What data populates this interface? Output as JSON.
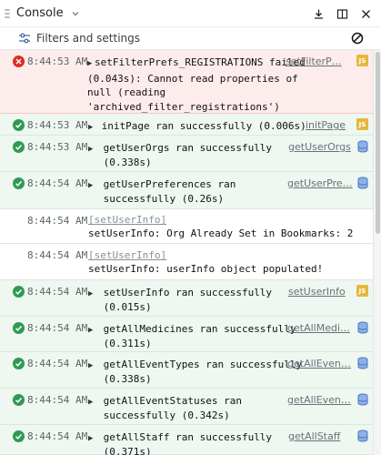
{
  "header": {
    "title": "Console",
    "icons": [
      "drag-handle-icon",
      "chevron-down-icon",
      "download-icon",
      "dock-side-icon",
      "close-icon"
    ]
  },
  "filter": {
    "label": "Filters and settings",
    "icons": [
      "filter-settings-icon",
      "clear-console-icon"
    ]
  },
  "colors": {
    "error_bg": "#fdecec",
    "success_bg": "#eef7f0",
    "error_icon": "#d93025",
    "success_icon": "#2f9a52",
    "js_badge": "#e5b83b",
    "db_badge": "#4a78c2"
  },
  "rows": [
    {
      "kind": "error",
      "time": "8:44:53 AM",
      "message": "setFilterPrefs_REGISTRATIONS failed\n(0.043s): Cannot read properties of\nnull (reading\n'archived_filter_registrations')",
      "source": "setFilterP…",
      "badge": "JS"
    },
    {
      "kind": "success",
      "time": "8:44:53 AM",
      "message": "initPage ran successfully (0.006s)",
      "source": "initPage",
      "badge": "JS"
    },
    {
      "kind": "success",
      "time": "8:44:53 AM",
      "message": "getUserOrgs ran successfully\n(0.338s)",
      "source": "getUserOrgs",
      "badge": "DB"
    },
    {
      "kind": "success",
      "time": "8:44:54 AM",
      "message": "getUserPreferences ran\nsuccessfully (0.26s)",
      "source": "getUserPre…",
      "badge": "DB"
    },
    {
      "kind": "plain",
      "time": "8:44:54 AM",
      "source_inline": "[setUserInfo]",
      "message": "setUserInfo: Org Already Set in Bookmarks: 2"
    },
    {
      "kind": "plain",
      "time": "8:44:54 AM",
      "source_inline": "[setUserInfo]",
      "message": "setUserInfo: userInfo object populated!"
    },
    {
      "kind": "success",
      "time": "8:44:54 AM",
      "message": "setUserInfo ran successfully\n(0.015s)",
      "source": "setUserInfo",
      "badge": "JS"
    },
    {
      "kind": "success",
      "time": "8:44:54 AM",
      "message": "getAllMedicines ran successfully\n(0.311s)",
      "source": "getAllMedi…",
      "badge": "DB"
    },
    {
      "kind": "success",
      "time": "8:44:54 AM",
      "message": "getAllEventTypes ran successfully\n(0.338s)",
      "source": "getAllEven…",
      "badge": "DB"
    },
    {
      "kind": "success",
      "time": "8:44:54 AM",
      "message": "getAllEventStatuses ran\nsuccessfully (0.342s)",
      "source": "getAllEven…",
      "badge": "DB"
    },
    {
      "kind": "success",
      "time": "8:44:54 AM",
      "message": "getAllStaff ran successfully\n(0.371s)",
      "source": "getAllStaff",
      "badge": "DB"
    }
  ]
}
